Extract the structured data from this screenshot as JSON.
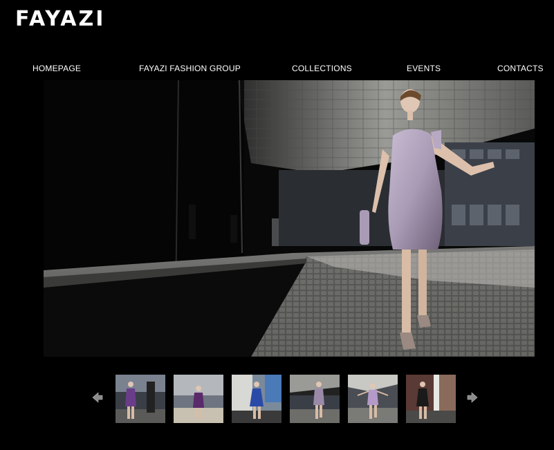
{
  "brand": {
    "logo_text": "FAYAZI"
  },
  "nav": {
    "items": [
      {
        "label": "HOMEPAGE"
      },
      {
        "label": "FAYAZI FASHION GROUP"
      },
      {
        "label": "COLLECTIONS"
      },
      {
        "label": "EVENTS"
      },
      {
        "label": "CONTACTS"
      }
    ]
  },
  "gallery": {
    "prev_icon": "arrow-left-icon",
    "next_icon": "arrow-right-icon",
    "thumbnails": [
      {
        "dress_color": "#6a3d8a"
      },
      {
        "dress_color": "#5a2a6a"
      },
      {
        "dress_color": "#2a4aa8"
      },
      {
        "dress_color": "#9a8aa8"
      },
      {
        "dress_color": "#b49ac8"
      },
      {
        "dress_color": "#1a1a1a"
      }
    ]
  },
  "colors": {
    "background": "#000000",
    "nav_text": "#ffffff",
    "hero_dress": "#a99bb5"
  }
}
